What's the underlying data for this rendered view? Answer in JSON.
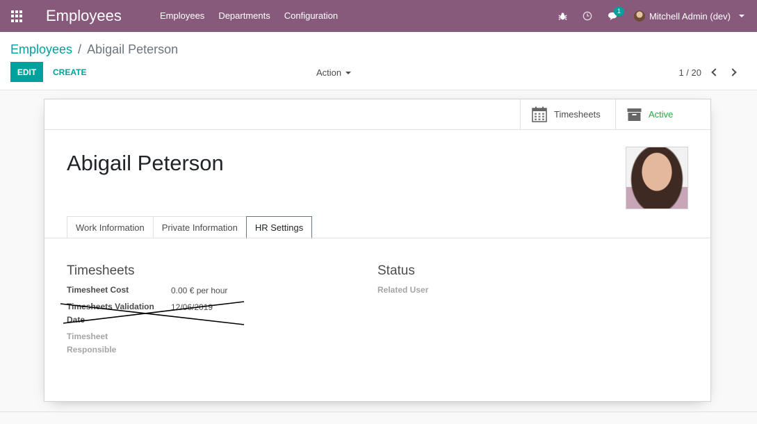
{
  "navbar": {
    "app_title": "Employees",
    "menu": [
      "Employees",
      "Departments",
      "Configuration"
    ],
    "message_count": "1",
    "user_name": "Mitchell Admin (dev)"
  },
  "control_panel": {
    "breadcrumb_parent": "Employees",
    "breadcrumb_separator": "/",
    "breadcrumb_current": "Abigail Peterson",
    "edit_label": "EDIT",
    "create_label": "CREATE",
    "action_label": "Action",
    "pager": "1 / 20"
  },
  "sheet": {
    "smart_buttons": {
      "timesheets": "Timesheets",
      "active": "Active"
    },
    "employee_name": "Abigail Peterson",
    "tabs": [
      "Work Information",
      "Private Information",
      "HR Settings"
    ],
    "active_tab": "HR Settings",
    "timesheets_group": {
      "title": "Timesheets",
      "cost_label": "Timesheet Cost",
      "cost_value": "0.00 € per hour",
      "validation_label_1": "Timesheets Validation",
      "validation_label_2": "Date",
      "validation_value": "12/06/2019",
      "responsible_label_1": "Timesheet",
      "responsible_label_2": "Responsible"
    },
    "status_group": {
      "title": "Status",
      "related_user_label": "Related User"
    }
  },
  "colors": {
    "brand": "#875a7b",
    "accent": "#00a09d",
    "active_green": "#28a745"
  }
}
